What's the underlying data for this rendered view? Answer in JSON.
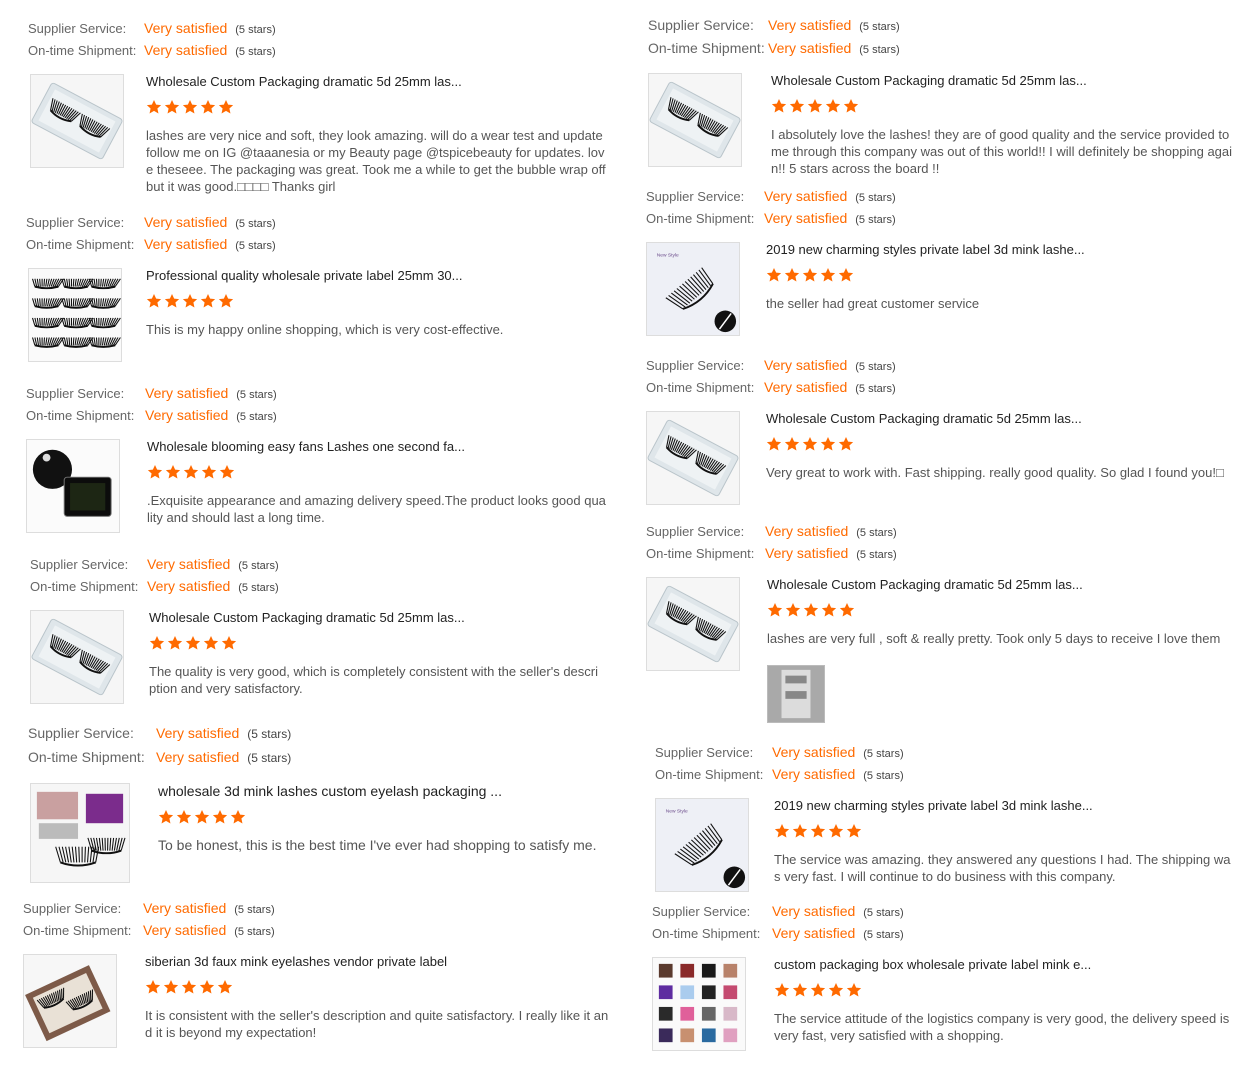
{
  "labels": {
    "supplier": "Supplier Service:",
    "shipment": "On-time Shipment:",
    "satisfied": "Very satisfied",
    "five_stars": "(5 stars)"
  },
  "colors": {
    "accent": "#ff6a00",
    "star": "#ff6a00"
  },
  "reviews": [
    {
      "title": "Wholesale Custom Packaging dramatic 5d 25mm las...",
      "comment": "lashes are very nice and soft, they look amazing. will do a wear test and update follow me on IG @taaanesia or my Beauty page @tspicebeauty for updates. love theseee. The packaging was great. Took me a while to get the bubble wrap off but it was good.□□□□ Thanks girl",
      "image": "lash-box-icon"
    },
    {
      "title": "Professional quality wholesale private label 25mm 30...",
      "comment": "This is my happy online shopping, which is very cost-effective.",
      "image": "lash-collection-icon"
    },
    {
      "title": "Wholesale blooming easy fans Lashes one second fa...",
      "comment": ".Exquisite appearance and amazing delivery speed.The product looks good quality and should last a long time.",
      "image": "lash-tray-icon"
    },
    {
      "title": "Wholesale Custom Packaging dramatic 5d 25mm las...",
      "comment": "The quality is very good, which is completely consistent with the seller's description and very satisfactory.",
      "image": "lash-box-icon"
    },
    {
      "title": "wholesale 3d mink lashes custom eyelash packaging ...",
      "comment": "To be honest, this is the best time I've ever had shopping to satisfy me.",
      "image": "lash-packaging-icon"
    },
    {
      "title": "siberian 3d faux mink eyelashes vendor private label",
      "comment": "It is consistent with the seller's description and quite satisfactory. I really like it and it is beyond my expectation!",
      "image": "lash-vendor-box-icon"
    },
    {
      "title": "Wholesale Custom Packaging dramatic 5d 25mm las...",
      "comment": "I absolutely love the lashes! they are of good quality and the service provided to me through this company was out of this world!! I will definitely be shopping again!! 5 stars across the board !!",
      "image": "lash-box-icon"
    },
    {
      "title": "2019 new charming styles private label 3d mink lashe...",
      "comment": "the seller had great customer service",
      "image": "single-lash-icon"
    },
    {
      "title": "Wholesale Custom Packaging dramatic 5d 25mm las...",
      "comment": "Very great to work with. Fast shipping. really good quality. So glad I found you!□",
      "image": "lash-box-icon"
    },
    {
      "title": "Wholesale Custom Packaging dramatic 5d 25mm las...",
      "comment": "lashes are very full , soft & really pretty. Took only 5 days to receive I love them",
      "image": "lash-box-icon"
    },
    {
      "title": "2019 new charming styles private label 3d mink lashe...",
      "comment": "The service was amazing. they answered any questions I had. The shipping was very fast. I will continue to do business with this company.",
      "image": "single-lash-icon"
    },
    {
      "title": "custom packaging box wholesale private label mink e...",
      "comment": "The service attitude of the logistics company is very good, the delivery speed is very fast, very satisfied with a shopping.",
      "image": "packaging-grid-icon"
    }
  ]
}
